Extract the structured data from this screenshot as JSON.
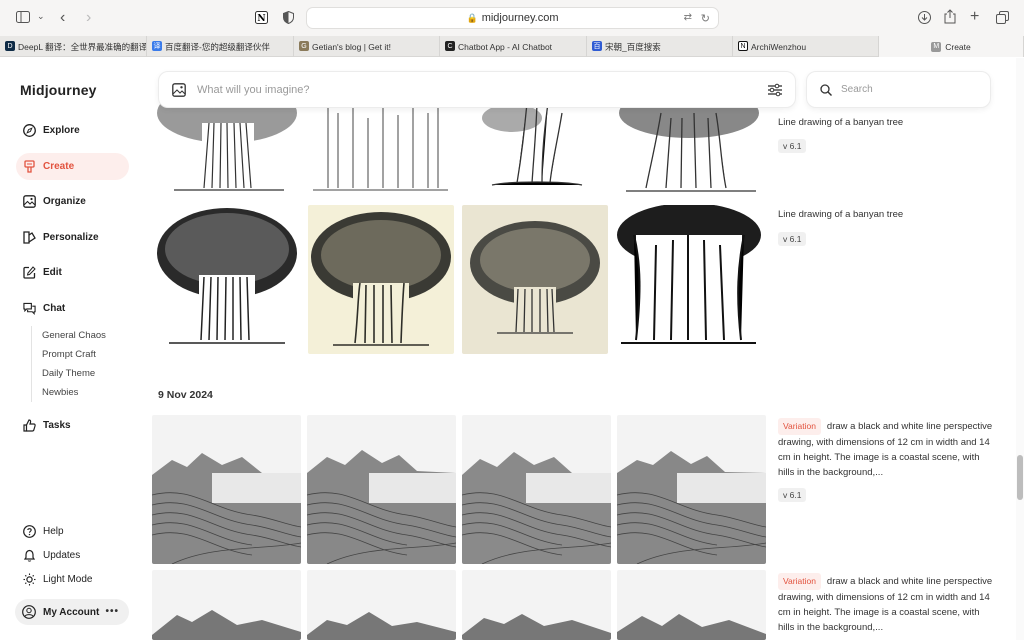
{
  "browser": {
    "url": "midjourney.com",
    "tabs": [
      {
        "label": "DeepL 翻译：全世界最准确的翻译",
        "fav_color": "#0f2b46",
        "fav_char": "D"
      },
      {
        "label": "百度翻译-您的超级翻译伙伴",
        "fav_color": "#3a7bea",
        "fav_char": "译"
      },
      {
        "label": "Getian's blog | Get it!",
        "fav_color": "#8a7a5a",
        "fav_char": "G"
      },
      {
        "label": "Chatbot App - AI Chatbot",
        "fav_color": "#222222",
        "fav_char": "C"
      },
      {
        "label": "宋朝_百度搜索",
        "fav_color": "#2f5bd3",
        "fav_char": "百"
      },
      {
        "label": "ArchiWenzhou",
        "fav_color": "#111111",
        "fav_char": "N"
      },
      {
        "label": "Create",
        "fav_color": "#999999",
        "fav_char": "M"
      }
    ]
  },
  "sidebar": {
    "brand": "Midjourney",
    "nav": [
      {
        "label": "Explore",
        "icon": "compass-icon"
      },
      {
        "label": "Create",
        "icon": "brush-icon"
      },
      {
        "label": "Organize",
        "icon": "image-icon"
      },
      {
        "label": "Personalize",
        "icon": "personalize-icon"
      },
      {
        "label": "Edit",
        "icon": "edit-icon"
      },
      {
        "label": "Chat",
        "icon": "chat-icon"
      }
    ],
    "chat_rooms": [
      "General Chaos",
      "Prompt Craft",
      "Daily Theme",
      "Newbies"
    ],
    "tasks": "Tasks",
    "bottom": [
      {
        "label": "Help",
        "icon": "help-icon"
      },
      {
        "label": "Updates",
        "icon": "bell-icon"
      },
      {
        "label": "Light Mode",
        "icon": "sun-icon"
      }
    ],
    "account": "My Account"
  },
  "main": {
    "imagine_placeholder": "What will you imagine?",
    "search_placeholder": "Search",
    "groups": [
      {
        "prompt": "Line drawing of a banyan tree",
        "version": "v 6.1"
      },
      {
        "prompt": "Line drawing of a banyan tree",
        "version": "v 6.1"
      }
    ],
    "date": "9 Nov 2024",
    "variation_groups": [
      {
        "tag": "Variation",
        "prompt": "draw a black and white line perspective drawing, with dimensions of 12 cm in width and 14 cm in height. The image is a coastal scene, with hills in the background,...",
        "version": "v 6.1"
      },
      {
        "tag": "Variation",
        "prompt": "draw a black and white line perspective drawing, with dimensions of 12 cm in width and 14 cm in height. The image is a coastal scene, with hills in the background,...",
        "version": ""
      }
    ]
  }
}
